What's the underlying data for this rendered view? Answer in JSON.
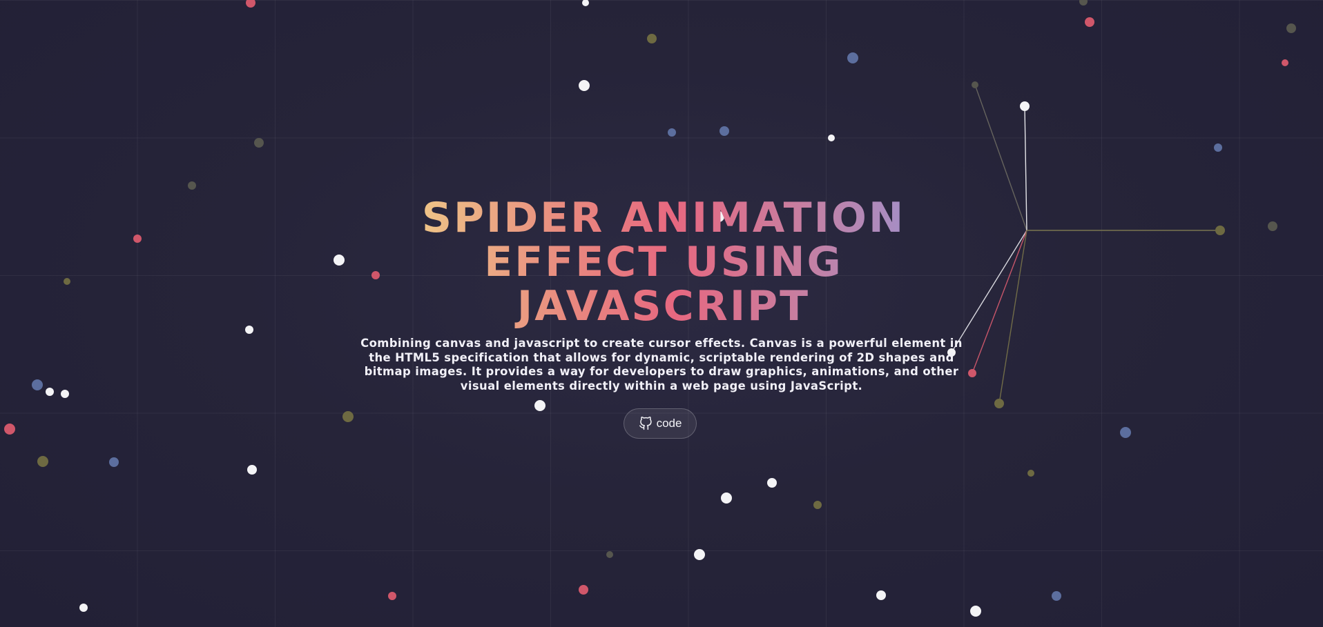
{
  "hero": {
    "title": "SPIDER ANIMATION EFFECT USING JAVASCRIPT",
    "description": "Combining canvas and javascript to create cursor effects. Canvas is a powerful element in the HTML5 specification that allows for dynamic, scriptable rendering of 2D shapes and bitmap images. It provides a way for developers to draw graphics, animations, and other visual elements directly within a web page using JavaScript.",
    "code_button_label": "code",
    "code_button_icon": "github-icon"
  },
  "colors": {
    "background": "#242238",
    "dot_white": "#f4f4f6",
    "dot_red": "#d0576a",
    "dot_blue": "#5c6e9e",
    "dot_olive": "#6e6a42",
    "dot_gray": "#56564e"
  }
}
